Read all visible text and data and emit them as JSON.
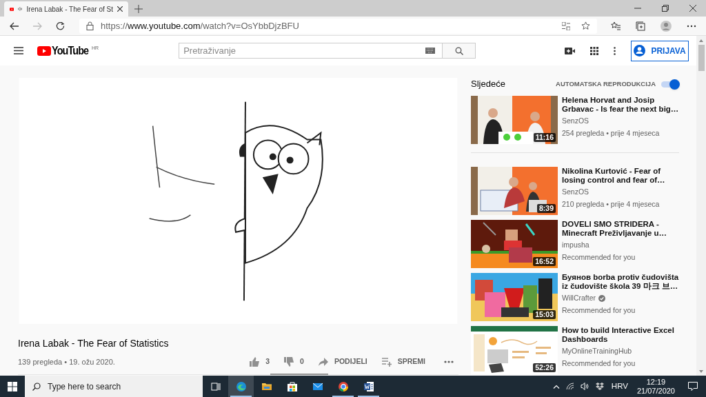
{
  "browser": {
    "tab": {
      "title": "Irena Labak - The Fear of St"
    },
    "url": {
      "scheme": "https://",
      "host": "www.youtube.com",
      "path": "/watch?v=OsYbbDjzBFU"
    }
  },
  "header": {
    "logo": "YouTube",
    "region": "HR",
    "search": {
      "placeholder": "Pretraživanje"
    },
    "sign_in": "PRIJAVA"
  },
  "video": {
    "title": "Irena Labak - The Fear of Statistics",
    "meta": "139 pregleda • 19. ožu 2020.",
    "actions": [
      {
        "kind": "like",
        "label": "3"
      },
      {
        "kind": "dislike",
        "label": "0"
      },
      {
        "kind": "share",
        "label": "PODIJELI"
      },
      {
        "kind": "save",
        "label": "SPREMI"
      },
      {
        "kind": "more"
      }
    ]
  },
  "sidebar": {
    "heading": "Sljedeće",
    "autoplay": {
      "label": "AUTOMATSKA REPRODUKCIJA",
      "on": true
    },
    "items": [
      {
        "title": "Helena Horvat and Josip Grbavac - Is fear the next big…",
        "channel": "SenzOS",
        "verified": false,
        "meta": "254 pregleda • prije 4 mjeseca",
        "duration": "11:16"
      },
      {
        "title": "Nikolina Kurtović - Fear of losing control and fear of…",
        "channel": "SenzOS",
        "verified": false,
        "meta": "210 pregleda • prije 4 mjeseca",
        "duration": "8:39"
      },
      {
        "title": "DOVELI SMO STRIDERA - Minecraft Preživljavanje u…",
        "channel": "impusha",
        "verified": false,
        "meta": "Recommended for you",
        "duration": "16:52"
      },
      {
        "title": "Буянов borba protiv čudovišta iz čudovište škola 39 마크 브…",
        "channel": "WillCrafter",
        "verified": true,
        "meta": "Recommended for you",
        "duration": "15:03"
      },
      {
        "title": "How to build Interactive Excel Dashboards",
        "channel": "MyOnlineTrainingHub",
        "verified": false,
        "meta": "Recommended for you",
        "duration": "52:26"
      }
    ]
  },
  "taskbar": {
    "search": {
      "placeholder": "Type here to search"
    },
    "apps": [
      {
        "kind": "taskview",
        "running": false
      },
      {
        "kind": "edge",
        "running": true
      },
      {
        "kind": "explorer",
        "running": false
      },
      {
        "kind": "store",
        "running": false
      },
      {
        "kind": "mail",
        "running": false
      },
      {
        "kind": "chrome",
        "running": true
      },
      {
        "kind": "word",
        "running": true
      }
    ],
    "language": "HRV",
    "time": "12:19",
    "date": "21/07/2020"
  }
}
